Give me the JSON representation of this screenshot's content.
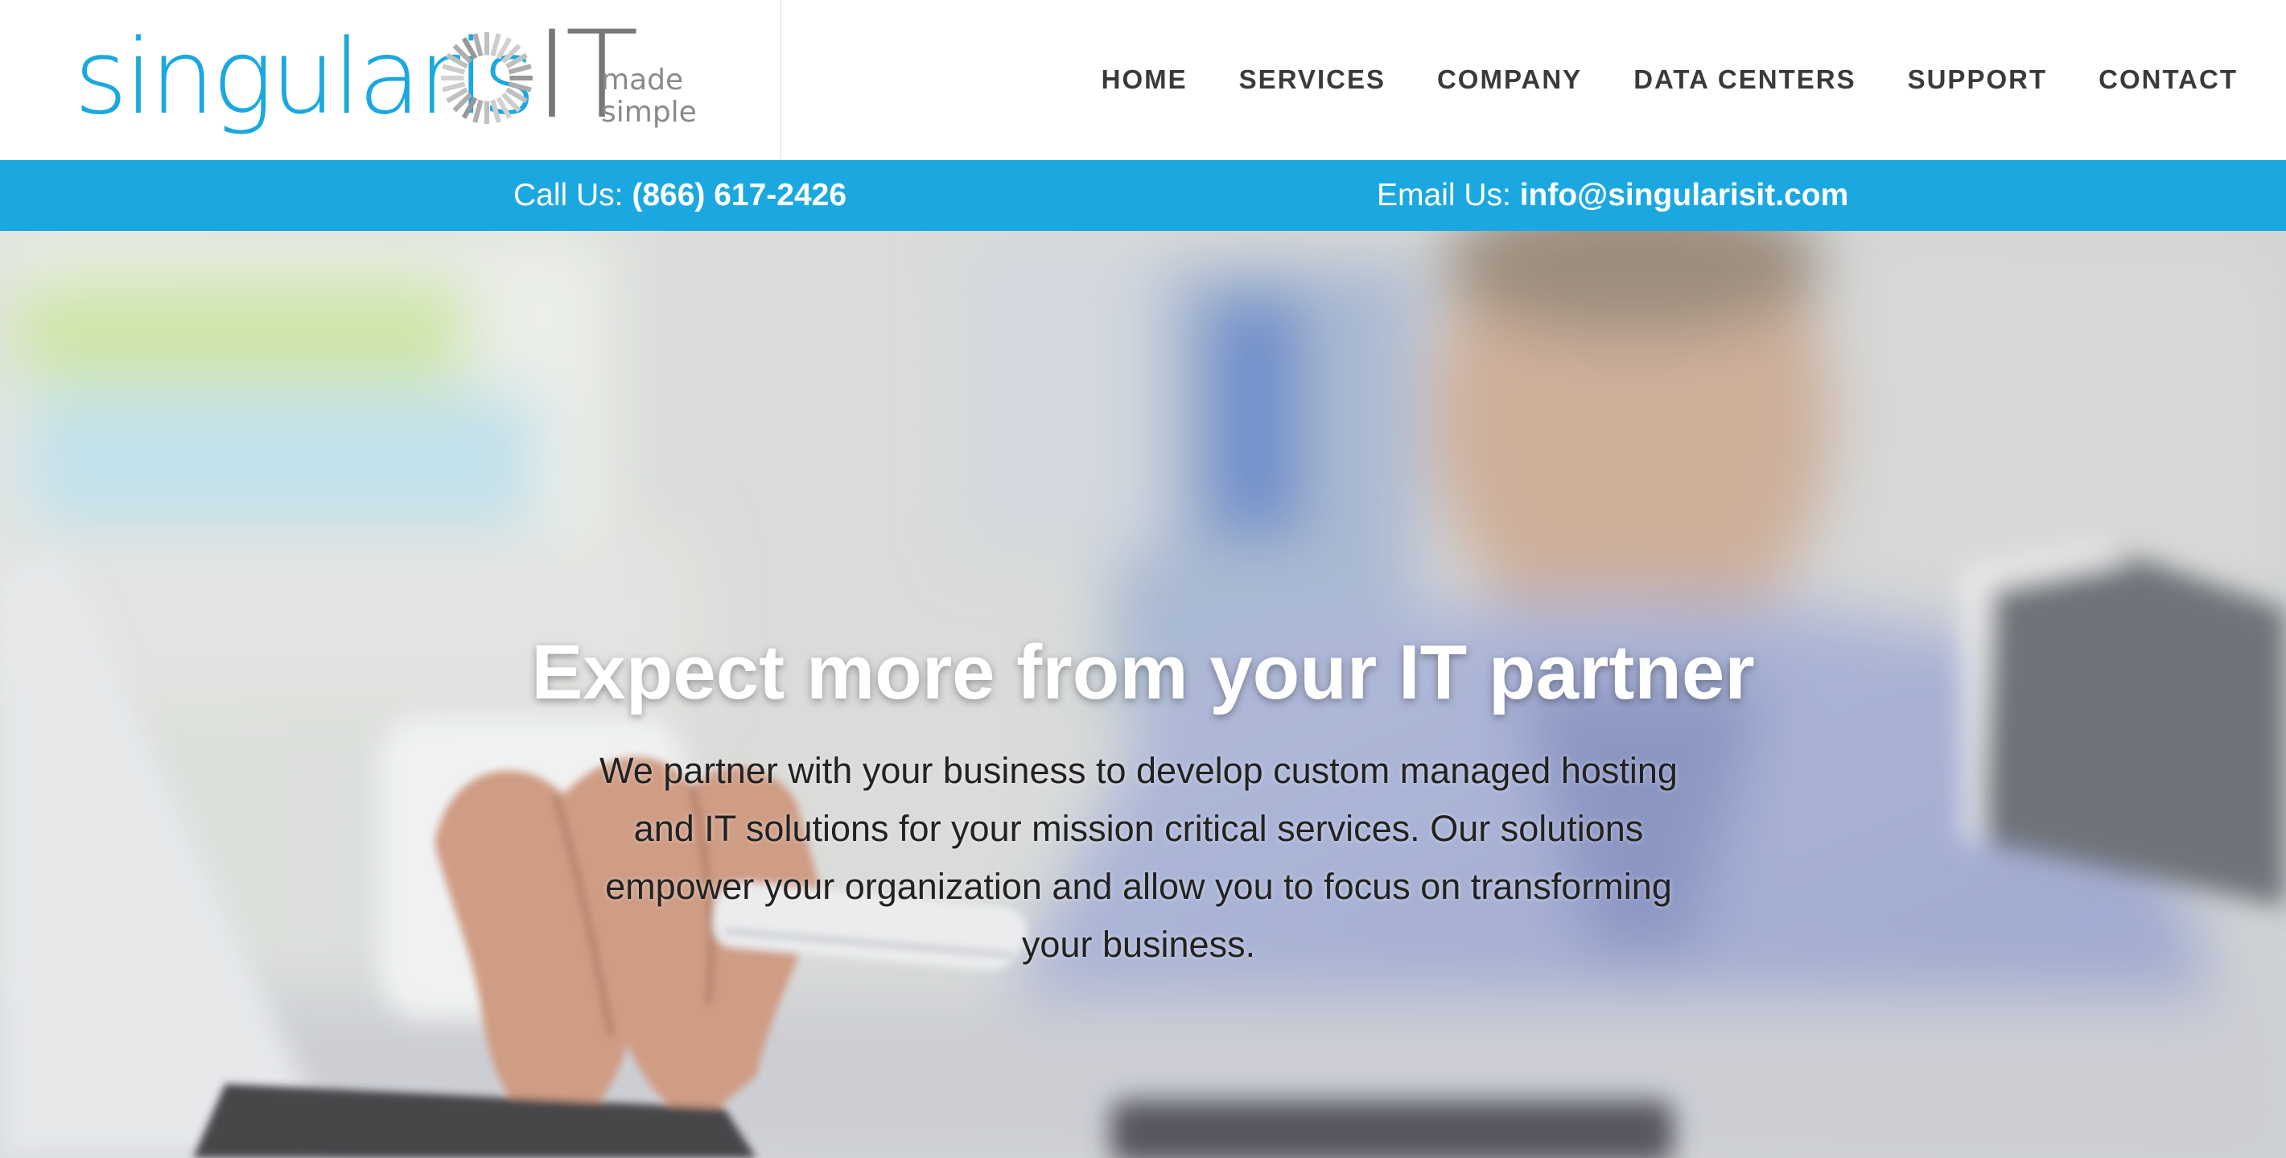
{
  "brand": {
    "name": "singularis",
    "suffix": "IT",
    "tagline_line1": "made",
    "tagline_line2": "simple",
    "color_primary": "#1ba8e0",
    "color_secondary": "#777777"
  },
  "nav": {
    "items": [
      {
        "label": "HOME"
      },
      {
        "label": "SERVICES"
      },
      {
        "label": "COMPANY"
      },
      {
        "label": "DATA CENTERS"
      },
      {
        "label": "SUPPORT"
      },
      {
        "label": "CONTACT"
      }
    ]
  },
  "contact_bar": {
    "call_label": "Call Us:",
    "call_value": "(866) 617-2426",
    "email_label": "Email Us:",
    "email_value": "info@singularisit.com",
    "background": "#1ba8e0"
  },
  "hero": {
    "title": "Expect more from your IT partner",
    "body": "We partner with your business to develop custom managed hosting and IT solutions for your mission critical services. Our solutions empower your organization and allow you to focus on transforming your business.",
    "image_subject": "blurred office photo of a man with a smartphone and laptop"
  }
}
